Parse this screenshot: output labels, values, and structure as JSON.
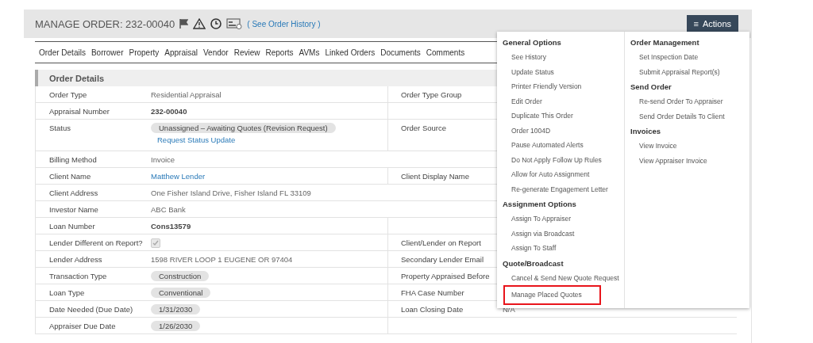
{
  "header": {
    "title": "MANAGE ORDER: 232-00040",
    "history_link": "( See Order History )",
    "actions_button": {
      "label": "Actions",
      "icon": "≡"
    }
  },
  "tabs": [
    {
      "label": "Order Details",
      "selected": false
    },
    {
      "label": "Borrower",
      "selected": false
    },
    {
      "label": "Property",
      "selected": false
    },
    {
      "label": "Appraisal",
      "selected": false
    },
    {
      "label": "Vendor",
      "selected": false
    },
    {
      "label": "Review",
      "selected": false
    },
    {
      "label": "Reports",
      "selected": false
    },
    {
      "label": "AVMs",
      "selected": false
    },
    {
      "label": "Linked Orders",
      "selected": false
    },
    {
      "label": "Documents",
      "selected": false
    },
    {
      "label": "Comments",
      "selected": false
    }
  ],
  "panel": {
    "title": "Order Details",
    "rows": [
      {
        "label": "Order Type",
        "value": {
          "kind": "text",
          "text": "Residential Appraisal"
        },
        "split": true,
        "right_label": "Order Type Group"
      },
      {
        "label": "Appraisal Number",
        "value": {
          "kind": "bold",
          "text": "232-00040"
        },
        "split": true
      },
      {
        "label": "Status",
        "value": {
          "kind": "pill",
          "text": "Unassigned – Awaiting Quotes (Revision Request)"
        },
        "sub_link": "Request Status Update",
        "split": true,
        "right_label": "Order Source"
      },
      {
        "label": "Billing Method",
        "value": {
          "kind": "text",
          "text": "Invoice"
        },
        "split": false
      },
      {
        "label": "Client Name",
        "value": {
          "kind": "link",
          "text": "Matthew Lender"
        },
        "split": true,
        "right_label": "Client Display Name"
      },
      {
        "label": "Client Address",
        "value": {
          "kind": "text",
          "text": "One Fisher Island Drive, Fisher Island FL 33109"
        },
        "split": false
      },
      {
        "label": "Investor Name",
        "value": {
          "kind": "text",
          "text": "ABC Bank"
        },
        "split": false
      },
      {
        "label": "Loan Number",
        "value": {
          "kind": "bold",
          "text": "Cons13579"
        },
        "split": true
      },
      {
        "label": "Lender Different on Report?",
        "value": {
          "kind": "checkbox",
          "checked": true
        },
        "split": true,
        "right_label": "Client/Lender on Report"
      },
      {
        "label": "Lender Address",
        "value": {
          "kind": "text",
          "text": "1598 RIVER LOOP 1 EUGENE OR 97404"
        },
        "split": true,
        "right_label": "Secondary Lender Email"
      },
      {
        "label": "Transaction Type",
        "value": {
          "kind": "pill",
          "text": "Construction"
        },
        "split": true,
        "right_label": "Property Appraised Before"
      },
      {
        "label": "Loan Type",
        "value": {
          "kind": "pill",
          "text": "Conventional"
        },
        "split": true,
        "right_label": "FHA Case Number"
      },
      {
        "label": "Date Needed (Due Date)",
        "value": {
          "kind": "pill",
          "text": "1/31/2030"
        },
        "split": true,
        "right_label": "Loan Closing Date",
        "right_value": "N/A"
      },
      {
        "label": "Appraiser Due Date",
        "value": {
          "kind": "pill",
          "text": "1/26/2030"
        },
        "split": true
      }
    ]
  },
  "actions_menu": {
    "columns": [
      {
        "sections": [
          {
            "heading": "General Options",
            "items": [
              {
                "label": "See History",
                "highlighted": false
              },
              {
                "label": "Update Status",
                "highlighted": false
              },
              {
                "label": "Printer Friendly Version",
                "highlighted": false
              },
              {
                "label": "Edit Order",
                "highlighted": false
              },
              {
                "label": "Duplicate This Order",
                "highlighted": false
              },
              {
                "label": "Order 1004D",
                "highlighted": false
              },
              {
                "label": "Pause Automated Alerts",
                "highlighted": false
              },
              {
                "label": "Do Not Apply Follow Up Rules",
                "highlighted": false
              },
              {
                "label": "Allow for Auto Assignment",
                "highlighted": false
              },
              {
                "label": "Re-generate Engagement Letter",
                "highlighted": false
              }
            ]
          },
          {
            "heading": "Assignment Options",
            "items": [
              {
                "label": "Assign To Appraiser",
                "highlighted": false
              },
              {
                "label": "Assign via Broadcast",
                "highlighted": false
              },
              {
                "label": "Assign To Staff",
                "highlighted": false
              }
            ]
          },
          {
            "heading": "Quote/Broadcast",
            "items": [
              {
                "label": "Cancel & Send New Quote Request",
                "highlighted": false
              },
              {
                "label": "Manage Placed Quotes",
                "highlighted": true
              }
            ]
          }
        ]
      },
      {
        "sections": [
          {
            "heading": "Order Management",
            "items": [
              {
                "label": "Set Inspection Date",
                "highlighted": false
              },
              {
                "label": "Submit Appraisal Report(s)",
                "highlighted": false
              }
            ]
          },
          {
            "heading": "Send Order",
            "items": [
              {
                "label": "Re-send Order To Appraiser",
                "highlighted": false
              },
              {
                "label": "Send Order Details To Client",
                "highlighted": false
              }
            ]
          },
          {
            "heading": "Invoices",
            "items": [
              {
                "label": "View Invoice",
                "highlighted": false
              },
              {
                "label": "View Appraiser Invoice",
                "highlighted": false
              }
            ]
          }
        ]
      }
    ]
  }
}
